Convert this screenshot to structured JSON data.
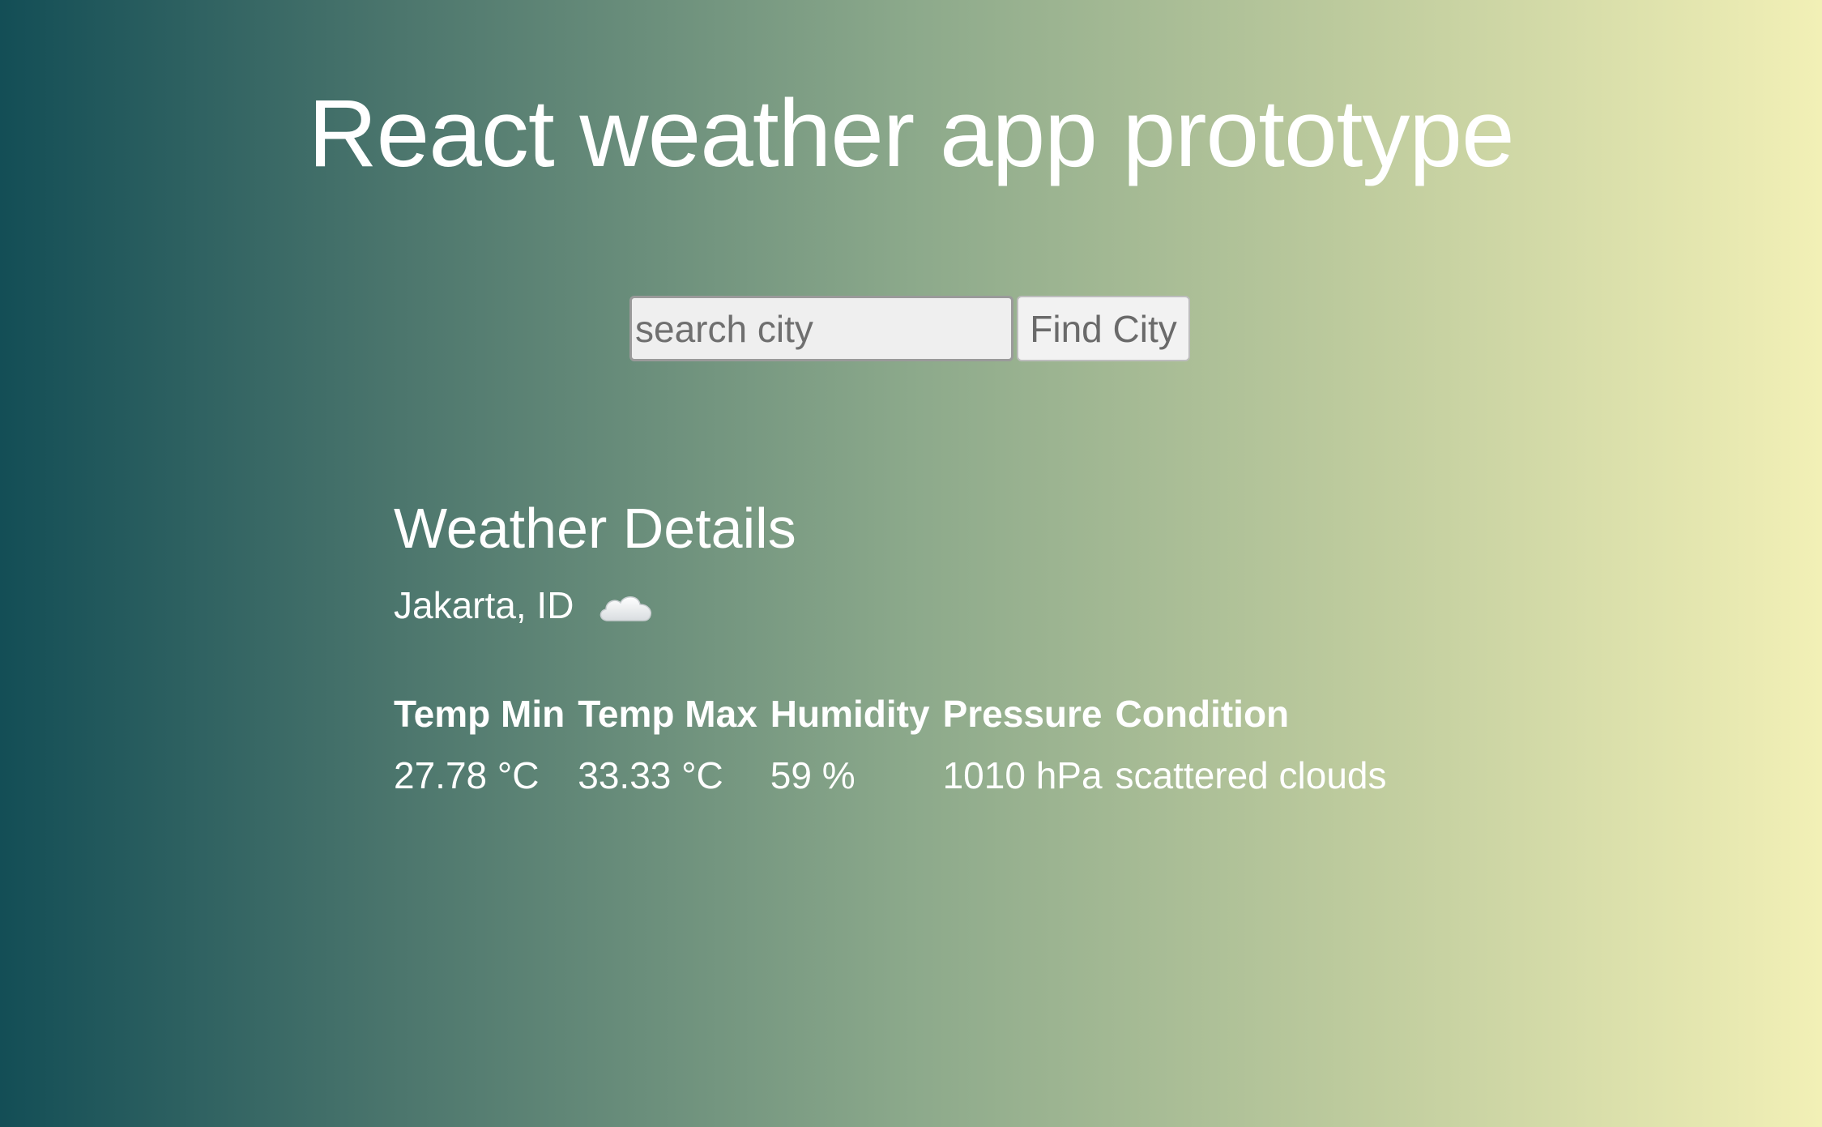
{
  "header": {
    "title": "React weather app prototype"
  },
  "search": {
    "placeholder": "search city",
    "value": "",
    "button_label": "Find City"
  },
  "details": {
    "title": "Weather Details",
    "location": "Jakarta, ID",
    "icon": "cloud-icon",
    "table": {
      "headers": [
        "Temp Min",
        "Temp Max",
        "Humidity",
        "Pressure",
        "Condition"
      ],
      "values": [
        "27.78 °C",
        "33.33 °C",
        "59 %",
        "1010 hPa",
        "scattered clouds"
      ]
    }
  },
  "colors": {
    "gradient_start": "#134e56",
    "gradient_end": "#f2f0b6",
    "text": "#ffffff"
  }
}
